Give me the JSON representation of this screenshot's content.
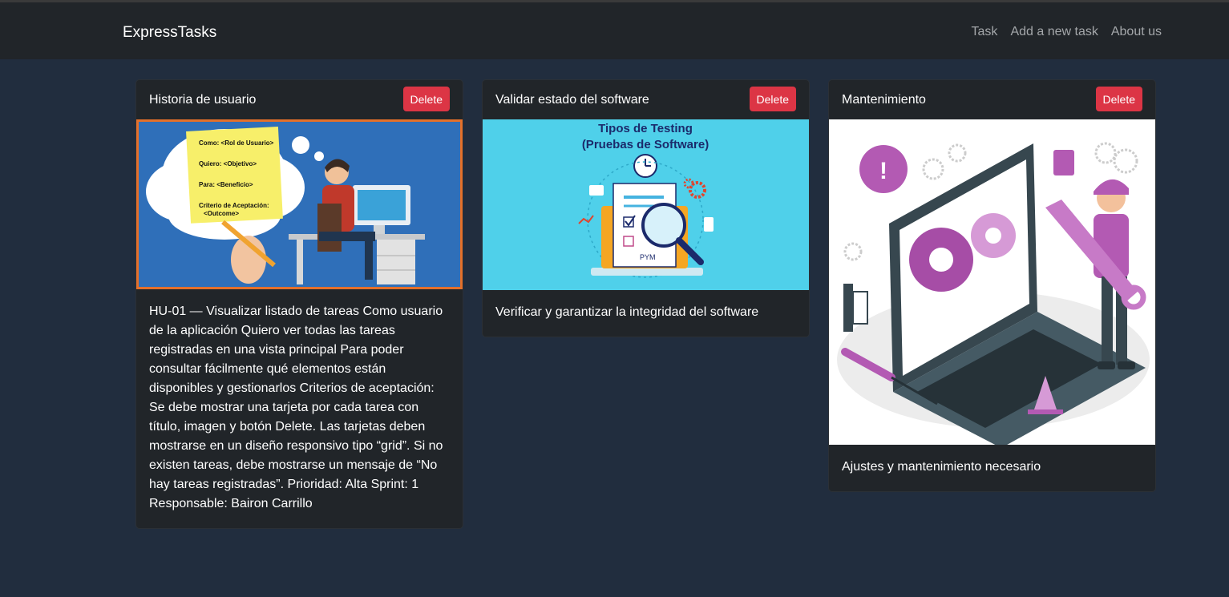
{
  "navbar": {
    "brand": "ExpressTasks",
    "links": [
      "Task",
      "Add a new task",
      "About us"
    ]
  },
  "cards": [
    {
      "title": "Historia de usuario",
      "delete_label": "Delete",
      "image_alt": "user-story-illustration",
      "image_text": {
        "line1": "Como: <Rol de Usuario>",
        "line2": "Quiero: <Objetivo>",
        "line3": "Para: <Beneficio>",
        "line4": "Criterio de Aceptación:",
        "line5": "<Outcome>"
      },
      "description": "HU-01 — Visualizar listado de tareas Como usuario de la aplicación Quiero ver todas las tareas registradas en una vista principal Para poder consultar fácilmente qué elementos están disponibles y gestionarlos Criterios de aceptación: Se debe mostrar una tarjeta por cada tarea con título, imagen y botón Delete. Las tarjetas deben mostrarse en un diseño responsivo tipo “grid”. Si no existen tareas, debe mostrarse un mensaje de “No hay tareas registradas”. Prioridad: Alta Sprint: 1 Responsable: Bairon Carrillo"
    },
    {
      "title": "Validar estado del software",
      "delete_label": "Delete",
      "image_alt": "software-testing-illustration",
      "image_text": {
        "line1": "Tipos de Testing",
        "line2": "(Pruebas de Software)",
        "logo": "PYM"
      },
      "description": "Verificar y garantizar la integridad del software"
    },
    {
      "title": "Mantenimiento",
      "delete_label": "Delete",
      "image_alt": "maintenance-illustration",
      "description": "Ajustes y mantenimiento necesario"
    }
  ],
  "colors": {
    "page_bg": "#212d3e",
    "navbar_bg": "#212529",
    "card_bg": "#212529",
    "danger": "#dc3545"
  }
}
